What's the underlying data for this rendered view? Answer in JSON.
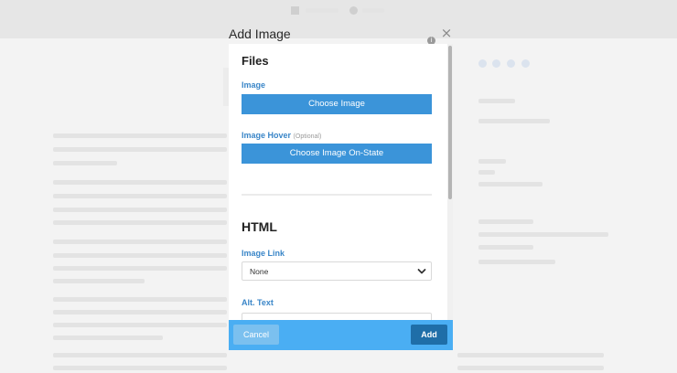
{
  "modal": {
    "title": "Add Image",
    "info_icon": "info-icon",
    "close_icon": "close-icon",
    "sections": {
      "files": {
        "heading": "Files",
        "image_label": "Image",
        "choose_image_button": "Choose Image",
        "image_hover_label": "Image Hover",
        "image_hover_optional": "(Optional)",
        "choose_on_state_button": "Choose Image On-State"
      },
      "html": {
        "heading": "HTML",
        "image_link_label": "Image Link",
        "image_link_value": "None",
        "alt_text_label": "Alt. Text",
        "alt_text_value": ""
      }
    },
    "footer": {
      "cancel_label": "Cancel",
      "add_label": "Add"
    }
  },
  "colors": {
    "primary_button": "#3b94d9",
    "footer_bar": "#4aaef3",
    "add_button": "#1f6ea8",
    "label_blue": "#3a86c8"
  }
}
